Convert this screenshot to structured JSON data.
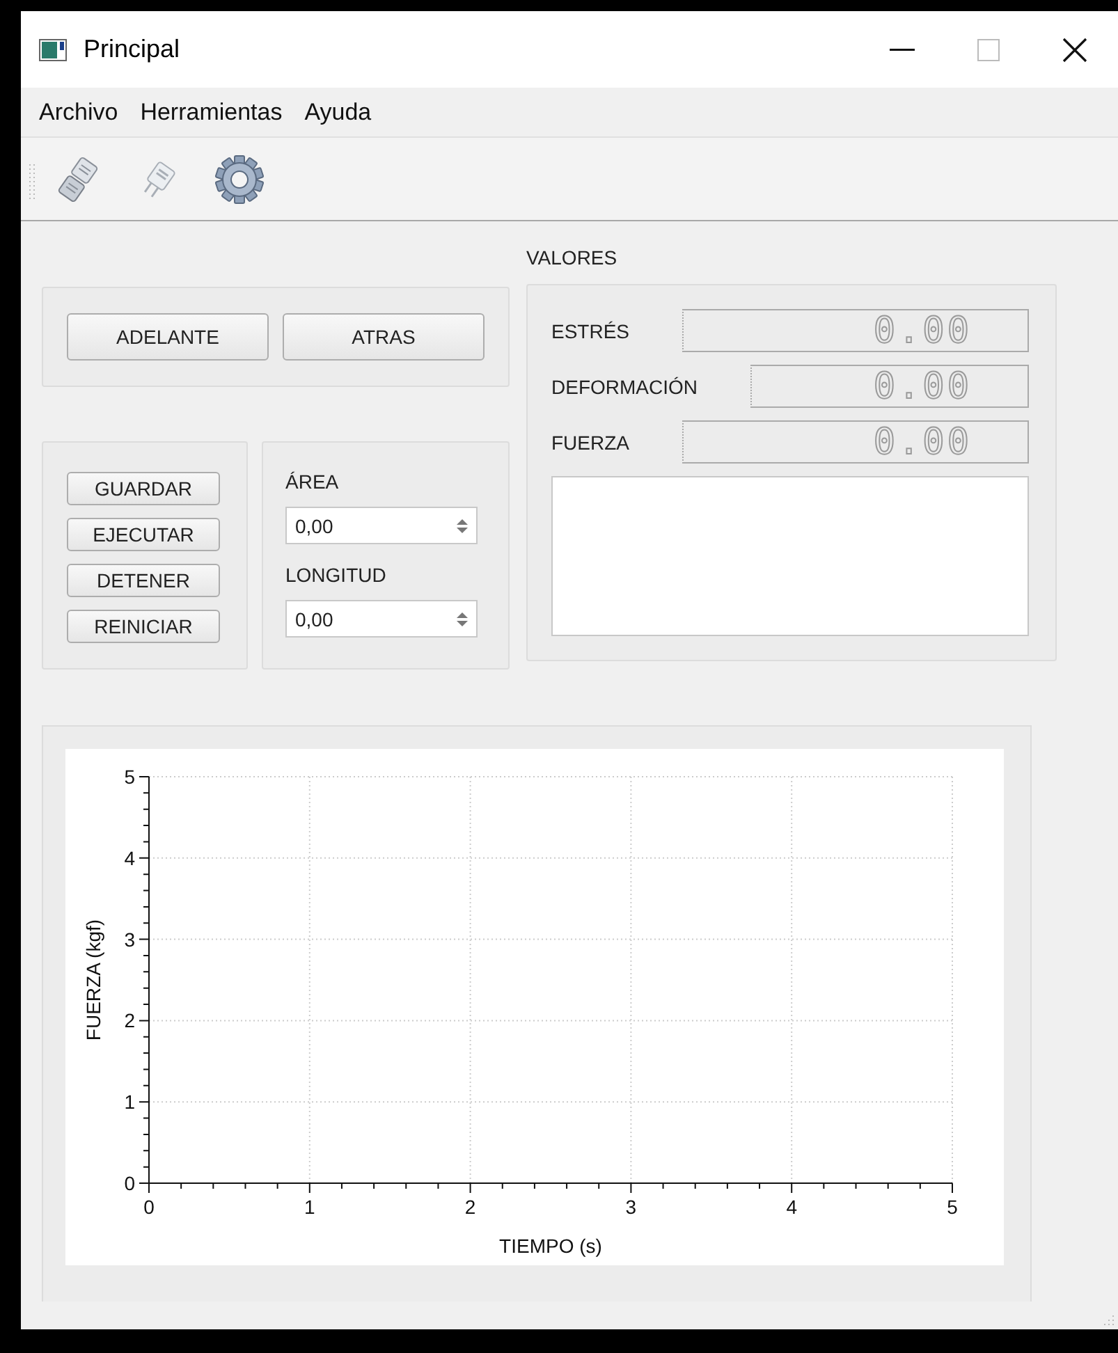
{
  "window": {
    "title": "Principal"
  },
  "menu": [
    "Archivo",
    "Herramientas",
    "Ayuda"
  ],
  "toolbar": [
    {
      "kind": "connect"
    },
    {
      "kind": "disconnect"
    },
    {
      "kind": "settings"
    }
  ],
  "motion_buttons": [
    "ADELANTE",
    "ATRAS"
  ],
  "control_buttons": [
    "GUARDAR",
    "EJECUTAR",
    "DETENER",
    "REINICIAR"
  ],
  "parameters": [
    {
      "label": "ÁREA",
      "value": "0,00"
    },
    {
      "label": "LONGITUD",
      "value": "0,00"
    }
  ],
  "values": {
    "title": "VALORES",
    "readings": [
      {
        "label": "ESTRÉS",
        "value": "0.00"
      },
      {
        "label": "DEFORMACIÓN",
        "value": "0.00"
      },
      {
        "label": "FUERZA",
        "value": "0.00"
      }
    ]
  },
  "chart": {
    "chart_data": {
      "type": "line",
      "grid": true,
      "xlabel": "TIEMPO (s)",
      "ylabel": "FUERZA (kgf)",
      "xlim": [
        0,
        5
      ],
      "ylim": [
        0,
        5
      ],
      "xticks": [
        0,
        1,
        2,
        3,
        4,
        5
      ],
      "yticks": [
        0,
        1,
        2,
        3,
        4,
        5
      ]
    }
  }
}
